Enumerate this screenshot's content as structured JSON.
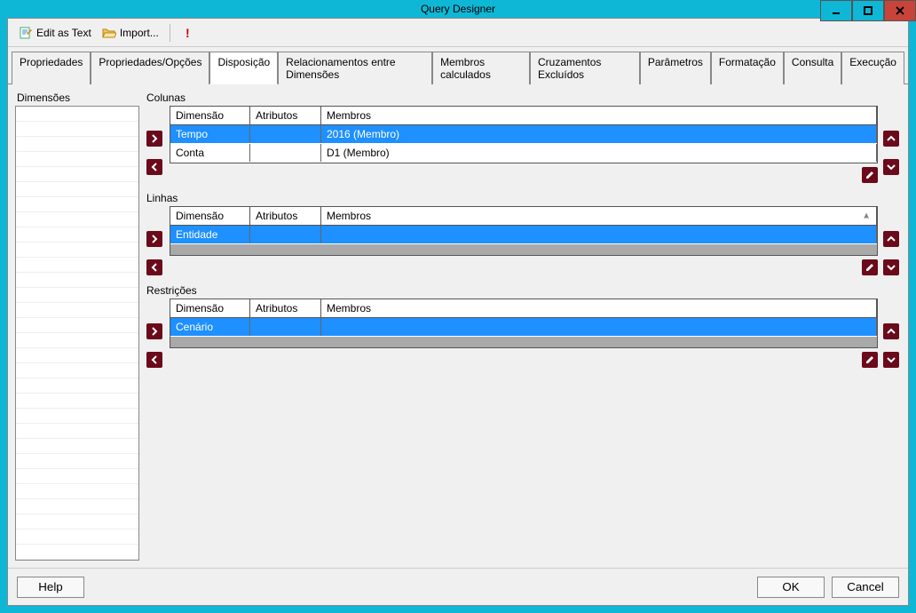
{
  "window": {
    "title": "Query Designer"
  },
  "toolbar": {
    "edit_as_text": "Edit as Text",
    "import": "Import..."
  },
  "tabs": [
    "Propriedades",
    "Propriedades/Opções",
    "Disposição",
    "Relacionamentos entre Dimensões",
    "Membros calculados",
    "Cruzamentos Excluídos",
    "Parâmetros",
    "Formatação",
    "Consulta",
    "Execução"
  ],
  "active_tab_index": 2,
  "side_panel": {
    "label": "Dimensões"
  },
  "sections": {
    "colunas": {
      "label": "Colunas",
      "headers": {
        "dim": "Dimensão",
        "attr": "Atributos",
        "mem": "Membros"
      },
      "rows": [
        {
          "dim": "Tempo",
          "attr": "",
          "mem": "2016 (Membro)",
          "selected": true
        },
        {
          "dim": "Conta",
          "attr": "",
          "mem": "D1 (Membro)",
          "selected": false
        }
      ]
    },
    "linhas": {
      "label": "Linhas",
      "headers": {
        "dim": "Dimensão",
        "attr": "Atributos",
        "mem": "Membros"
      },
      "rows": [
        {
          "dim": "Entidade",
          "attr": "",
          "mem": "",
          "selected": true
        }
      ]
    },
    "restricoes": {
      "label": "Restrições",
      "headers": {
        "dim": "Dimensão",
        "attr": "Atributos",
        "mem": "Membros"
      },
      "rows": [
        {
          "dim": "Cenário",
          "attr": "",
          "mem": "",
          "selected": true
        }
      ]
    }
  },
  "footer": {
    "help": "Help",
    "ok": "OK",
    "cancel": "Cancel"
  }
}
